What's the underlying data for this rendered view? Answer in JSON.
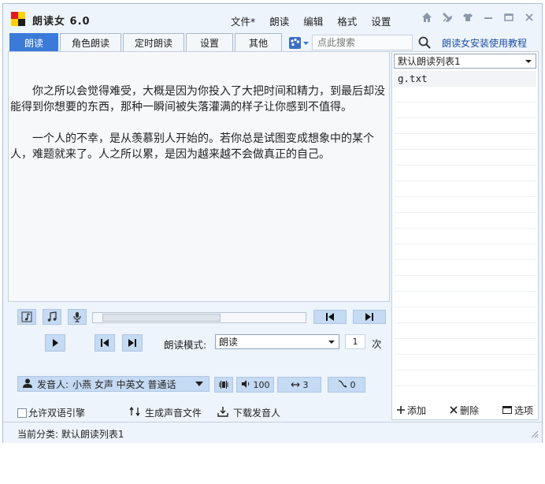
{
  "app": {
    "title": "朗读女 6.0"
  },
  "menu": [
    "文件*",
    "朗读",
    "编辑",
    "格式",
    "设置"
  ],
  "window_controls": [
    "home-icon",
    "pin-icon",
    "shirt-icon",
    "minimize-icon",
    "maximize-icon",
    "close-icon"
  ],
  "tabs": [
    {
      "label": "朗读",
      "active": true
    },
    {
      "label": "角色朗读",
      "active": false
    },
    {
      "label": "定时朗读",
      "active": false
    },
    {
      "label": "设置",
      "active": false
    },
    {
      "label": "其他",
      "active": false
    }
  ],
  "search": {
    "placeholder": "点此搜索"
  },
  "help_link": "朗读女安装使用教程",
  "editor": {
    "paragraphs": [
      "你之所以会觉得难受，大概是因为你投入了大把时间和精力，到最后却没能得到你想要的东西，那种一瞬间被失落灌满的样子让你感到不值得。",
      "一个人的不幸，是从羡慕别人开始的。若你总是试图变成想象中的某个人，难题就来了。人之所以累，是因为越来越不会做真正的自己。"
    ]
  },
  "playlist": {
    "selected": "默认朗读列表1",
    "items": [
      "g.txt"
    ],
    "actions": {
      "add": "添加",
      "delete": "删除",
      "options": "选项"
    }
  },
  "controls": {
    "mode_label": "朗读模式:",
    "mode_value": "朗读",
    "repeat_count": "1",
    "repeat_unit": "次",
    "speaker_prefix": "发音人:",
    "speaker_value": "小燕 女声 中英文 普通话",
    "volume": "100",
    "speed": "3",
    "pitch": "0",
    "bilingual_label": "允许双语引擎",
    "generate_audio": "生成声音文件",
    "download_speaker": "下载发音人"
  },
  "status": {
    "text": "当前分类: 默认朗读列表1"
  },
  "colors": {
    "accent": "#3b7ad8",
    "button_bg": "#c5daf3",
    "window_bg": "#eef4fb",
    "link": "#1a4fa6"
  }
}
